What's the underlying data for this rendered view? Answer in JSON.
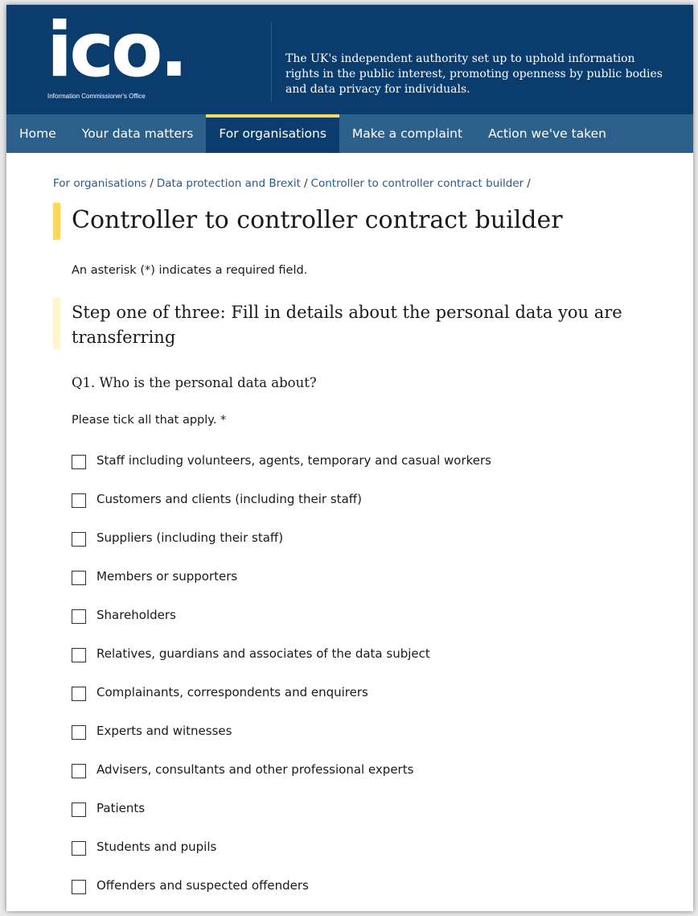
{
  "header": {
    "logo_text": "ico.",
    "logo_subtitle": "Information Commissioner's Office",
    "tagline": "The UK's independent authority set up to uphold information rights in the public interest, promoting openness by public bodies and data privacy for individuals.",
    "brand_color": "#0a3d6e",
    "accent_color": "#ffd75e"
  },
  "nav": {
    "items": [
      {
        "label": "Home"
      },
      {
        "label": "Your data matters"
      },
      {
        "label": "For organisations"
      },
      {
        "label": "Make a complaint"
      },
      {
        "label": "Action we've taken"
      }
    ],
    "active_index": 2
  },
  "breadcrumb": {
    "items": [
      "For organisations",
      "Data protection and Brexit",
      "Controller to controller contract builder"
    ],
    "separator": "/"
  },
  "page": {
    "title": "Controller to controller contract builder",
    "required_note": "An asterisk (*) indicates a required field.",
    "step_heading": "Step one of three: Fill in details about the personal data you are transferring",
    "question": "Q1. Who is the personal data about?",
    "instruction": "Please tick all that apply. *"
  },
  "options": [
    {
      "label": "Staff including volunteers, agents, temporary and casual workers",
      "checked": false
    },
    {
      "label": "Customers and clients (including their staff)",
      "checked": false
    },
    {
      "label": "Suppliers (including their staff)",
      "checked": false
    },
    {
      "label": "Members or supporters",
      "checked": false
    },
    {
      "label": "Shareholders",
      "checked": false
    },
    {
      "label": "Relatives, guardians and associates of the data subject",
      "checked": false
    },
    {
      "label": "Complainants, correspondents and enquirers",
      "checked": false
    },
    {
      "label": "Experts and witnesses",
      "checked": false
    },
    {
      "label": "Advisers, consultants and other professional experts",
      "checked": false
    },
    {
      "label": "Patients",
      "checked": false
    },
    {
      "label": "Students and pupils",
      "checked": false
    },
    {
      "label": "Offenders and suspected offenders",
      "checked": false
    }
  ]
}
